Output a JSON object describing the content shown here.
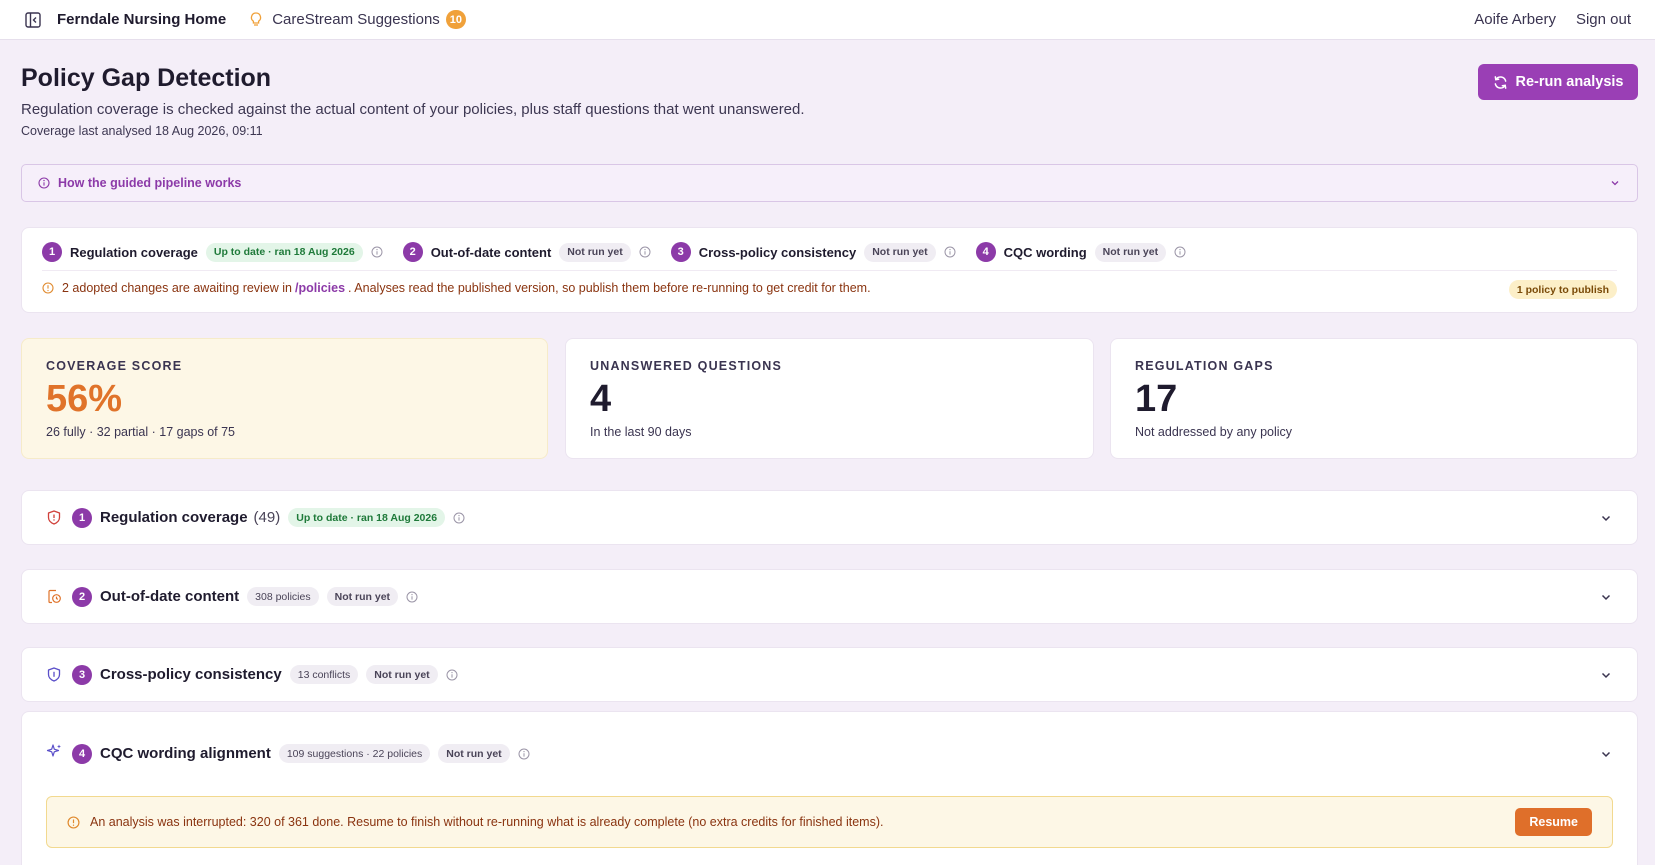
{
  "topbar": {
    "org_name": "Ferndale Nursing Home",
    "suggestions_label": "CareStream Suggestions",
    "suggestions_count": "10",
    "user_name": "Aoife Arbery",
    "signout_label": "Sign out"
  },
  "header": {
    "title": "Policy Gap Detection",
    "description": "Regulation coverage is checked against the actual content of your policies, plus staff questions that went unanswered.",
    "last_analysed": "Coverage last analysed 18 Aug 2026, 09:11",
    "rerun_label": "Re-run analysis"
  },
  "how_it_works": {
    "label": "How the guided pipeline works"
  },
  "pipeline": {
    "steps": [
      {
        "num": "1",
        "name": "Regulation coverage",
        "status": "Up to date · ran 18 Aug 2026"
      },
      {
        "num": "2",
        "name": "Out-of-date content",
        "status": "Not run yet"
      },
      {
        "num": "3",
        "name": "Cross-policy consistency",
        "status": "Not run yet"
      },
      {
        "num": "4",
        "name": "CQC wording",
        "status": "Not run yet"
      }
    ],
    "warning_pre": "2 adopted changes are awaiting review in",
    "warning_link": "/policies",
    "warning_post": ". Analyses read the published version, so publish them before re-running to get credit for them.",
    "publish_badge": "1 policy to publish"
  },
  "stats": [
    {
      "label": "COVERAGE SCORE",
      "value": "56%",
      "sub": "26 fully · 32 partial · 17 gaps of 75"
    },
    {
      "label": "UNANSWERED QUESTIONS",
      "value": "4",
      "sub": "In the last 90 days"
    },
    {
      "label": "REGULATION GAPS",
      "value": "17",
      "sub": "Not addressed by any policy"
    }
  ],
  "sections": [
    {
      "num": "1",
      "title": "Regulation coverage",
      "count": "(49)",
      "status": "Up to date · ran 18 Aug 2026"
    },
    {
      "num": "2",
      "title": "Out-of-date content",
      "tag": "308 policies",
      "status": "Not run yet"
    },
    {
      "num": "3",
      "title": "Cross-policy consistency",
      "tag": "13 conflicts",
      "status": "Not run yet"
    },
    {
      "num": "4",
      "title": "CQC wording alignment",
      "tag": "109 suggestions · 22 policies",
      "status": "Not run yet"
    }
  ],
  "interrupt": {
    "message": "An analysis was interrupted: 320 of 361 done. Resume to finish without re-running what is already complete (no extra credits for finished items).",
    "resume_label": "Resume"
  },
  "colors": {
    "accent": "#8c3aa8",
    "button": "#9a3fb5",
    "warning": "#df6f2a",
    "success": "#1f7a3a",
    "background": "#f4eef8"
  },
  "icons": {
    "sidebar_toggle": "sidebar-toggle-icon",
    "suggestions": "lightbulb-icon",
    "rerun": "refresh-icon",
    "info": "info-icon",
    "warning": "warning-circle-icon",
    "chevron": "chevron-down-icon",
    "section1": "shield-alert-icon",
    "section2": "document-clock-icon",
    "section3": "shield-icon",
    "section4": "sparkles-icon"
  }
}
